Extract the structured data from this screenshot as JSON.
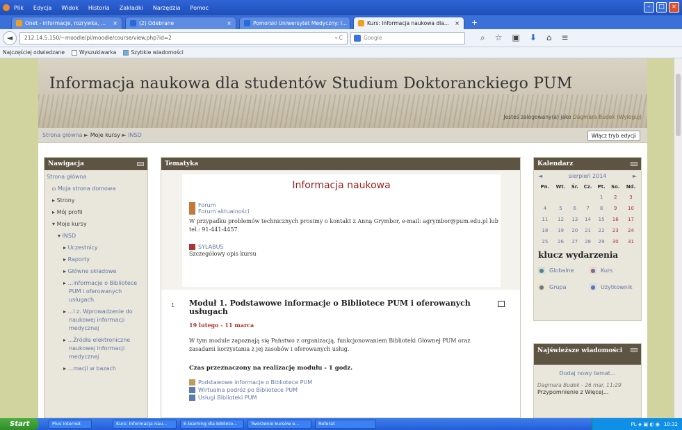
{
  "browser": {
    "menu": [
      "Plik",
      "Edycja",
      "Widok",
      "Historia",
      "Zakładki",
      "Narzędzia",
      "Pomoc"
    ],
    "tabs": [
      {
        "label": "Onet - informacje, rozrywka, ...",
        "active": false,
        "icon_color": "#f0a020"
      },
      {
        "label": "(2) Odebrane",
        "active": false,
        "icon_color": "#2a6ad8"
      },
      {
        "label": "Pomorski Uniwersytet Medyczny: I...",
        "active": false,
        "icon_color": "#2a6ad8"
      },
      {
        "label": "Kurs: Informacja naukowa dla...",
        "active": true,
        "icon_color": "#f0a020"
      }
    ],
    "url": "212.14.5.150/~moodle/pl/moodle/course/view.php?id=2",
    "search_placeholder": "Google",
    "bookmarks": [
      "Najczęściej odwiedzane",
      "Wyszukiwarka",
      "Szybkie wiadomości"
    ]
  },
  "site": {
    "title": "Informacja naukowa dla studentów Studium Doktoranckiego PUM",
    "login_prefix": "Jesteś zalogowany(a) jako",
    "login_user": "Dagmara Budek",
    "logout": "(Wyloguj)"
  },
  "breadcrumb": {
    "home": "Strona główna",
    "my_courses": "Moje kursy",
    "current": "INSD"
  },
  "edit_button": "Włącz tryb edycji",
  "nav": {
    "title": "Nawigacja",
    "items": [
      {
        "label": "Strona główna",
        "level": 0,
        "dark": false,
        "bullet": ""
      },
      {
        "label": "Moja strona domowa",
        "level": 1,
        "dark": false,
        "bullet": "▫"
      },
      {
        "label": "Strony",
        "level": 1,
        "dark": true,
        "bullet": "▸"
      },
      {
        "label": "Mój profil",
        "level": 1,
        "dark": true,
        "bullet": "▸"
      },
      {
        "label": "Moje kursy",
        "level": 1,
        "dark": true,
        "bullet": "▾"
      },
      {
        "label": "INSD",
        "level": 2,
        "dark": false,
        "bullet": "▾"
      },
      {
        "label": "Uczestnicy",
        "level": 3,
        "dark": false,
        "bullet": "▸"
      },
      {
        "label": "Raporty",
        "level": 3,
        "dark": false,
        "bullet": "▸"
      },
      {
        "label": "Główne składowe",
        "level": 3,
        "dark": false,
        "bullet": "▸"
      },
      {
        "label": "...informacje o Bibliotece PUM i oferowanych usługach",
        "level": 3,
        "dark": false,
        "bullet": "▸"
      },
      {
        "label": "...l z. Wprowadzenie do naukowej informacji medycznej",
        "level": 3,
        "dark": false,
        "bullet": "▸"
      },
      {
        "label": "...Źródła elektroniczne naukowej informacji medycznej",
        "level": 3,
        "dark": false,
        "bullet": "▸"
      },
      {
        "label": "...macji w bazach",
        "level": 3,
        "dark": false,
        "bullet": "▸"
      }
    ]
  },
  "main": {
    "title": "Tematyka",
    "section0": {
      "heading": "Informacja naukowa",
      "forum": "Forum",
      "news": "Forum aktualności",
      "contact": "W przypadku problemów technicznych prosimy o kontakt z Anną Grymbor, e-mail: agrymbor@pum.edu.pl lub tel.: 91-441-4457.",
      "syllabus": "SYLABUS",
      "syllabus_desc": "Szczegółowy opis kursu"
    },
    "section1": {
      "num": "1",
      "title": "Moduł 1. Podstawowe informacje o Bibliotece PUM i oferowanych usługach",
      "date": "19 lutego - 11 marca",
      "description": "W tym module zapoznają się Państwo z organizacją, funkcjonowaniem Biblioteki Głównej PUM oraz zasadami korzystania z jej zasobów i oferowanych usług.",
      "time": "Czas przeznaczony na realizację modułu - 1 godz.",
      "links": [
        "Podstawowe informacje o Bibliotece PUM",
        "Wirtualna podróż po Bibliotece PUM",
        "Usługi Biblioteki PUM"
      ]
    }
  },
  "calendar": {
    "title": "Kalendarz",
    "prev": "◄",
    "next": "►",
    "month": "sierpień 2014",
    "days": [
      "Pn.",
      "Wt.",
      "Śr.",
      "Cz.",
      "Pt.",
      "So.",
      "Nd."
    ],
    "weeks": [
      [
        "",
        "",
        "",
        "",
        "1",
        "2",
        "3"
      ],
      [
        "4",
        "5",
        "6",
        "7",
        "8",
        "9",
        "10"
      ],
      [
        "11",
        "12",
        "13",
        "14",
        "15",
        "16",
        "17"
      ],
      [
        "18",
        "19",
        "20",
        "21",
        "22",
        "23",
        "24"
      ],
      [
        "25",
        "26",
        "27",
        "28",
        "29",
        "30",
        "31"
      ]
    ],
    "key_title": "klucz wydarzenia",
    "keys": [
      "Globalne",
      "Kurs",
      "Grupa",
      "Użytkownik"
    ]
  },
  "news": {
    "title": "Najświeższe wiadomości",
    "add": "Dodaj nowy temat...",
    "item_meta": "Dagmara Budek - 26 mar, 11:29",
    "item_text": "Przypomnienie z Więcej..."
  },
  "taskbar": {
    "start": "Start",
    "tasks": [
      "Plus Internet",
      "Kurs: Informacja nau...",
      "E-learning dla biblioto...",
      "Tworzenie kursów e...",
      "Referat"
    ],
    "clock": "10:32"
  }
}
